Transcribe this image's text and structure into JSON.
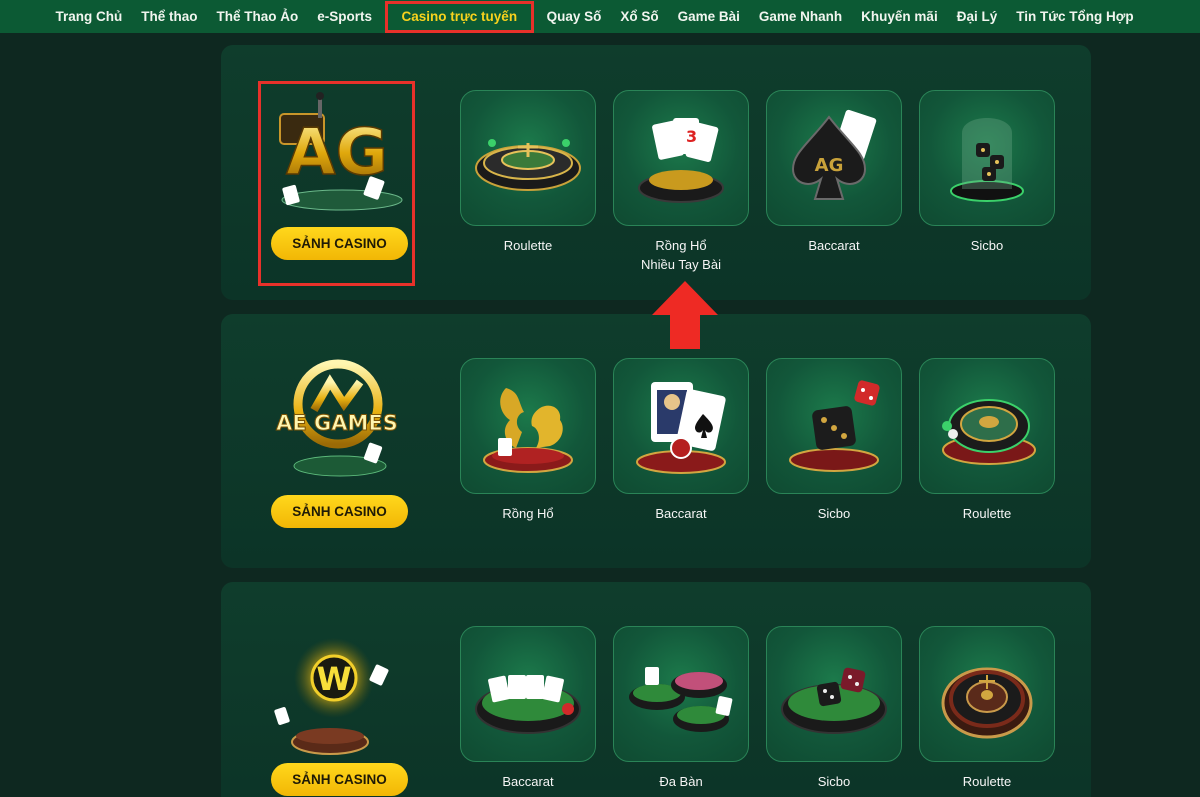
{
  "nav": {
    "items": [
      "Trang Chủ",
      "Thể thao",
      "Thể Thao Ảo",
      "e-Sports",
      "Casino trực tuyến",
      "Quay Số",
      "Xổ Số",
      "Game Bài",
      "Game Nhanh",
      "Khuyến mãi",
      "Đại Lý",
      "Tin Tức Tổng Hợp"
    ],
    "active_index": 4
  },
  "providers": [
    {
      "logo_text": "AG",
      "lobby_label": "SẢNH CASINO",
      "games": [
        {
          "label": "Roulette",
          "icon": "roulette-wheel-icon"
        },
        {
          "label": "Rồng Hổ\nNhiều Tay Bài",
          "line1": "Rồng Hổ",
          "line2": "Nhiều Tay Bài",
          "icon": "cards-chips-icon"
        },
        {
          "label": "Baccarat",
          "icon": "spade-ag-icon"
        },
        {
          "label": "Sicbo",
          "icon": "dice-cup-icon"
        }
      ]
    },
    {
      "logo_text": "AE GAMES",
      "lobby_label": "SẢNH CASINO",
      "games": [
        {
          "label": "Rồng Hổ",
          "icon": "dragon-tiger-icon"
        },
        {
          "label": "Baccarat",
          "icon": "king-card-icon"
        },
        {
          "label": "Sicbo",
          "icon": "dice-icon"
        },
        {
          "label": "Roulette",
          "icon": "roulette-wheel-icon"
        }
      ]
    },
    {
      "logo_text": "W",
      "lobby_label": "SẢNH CASINO",
      "games": [
        {
          "label": "Baccarat",
          "icon": "card-table-icon"
        },
        {
          "label": "Đa Bàn",
          "icon": "multi-table-icon"
        },
        {
          "label": "Sicbo",
          "icon": "dice-table-icon"
        },
        {
          "label": "Roulette",
          "icon": "roulette-wheel-icon"
        }
      ]
    }
  ],
  "colors": {
    "nav_bg": "#0c5a34",
    "active_text": "#f7d21d",
    "highlight": "#e8312a",
    "button": "#ffd81c",
    "page_bg": "#0e2820"
  }
}
